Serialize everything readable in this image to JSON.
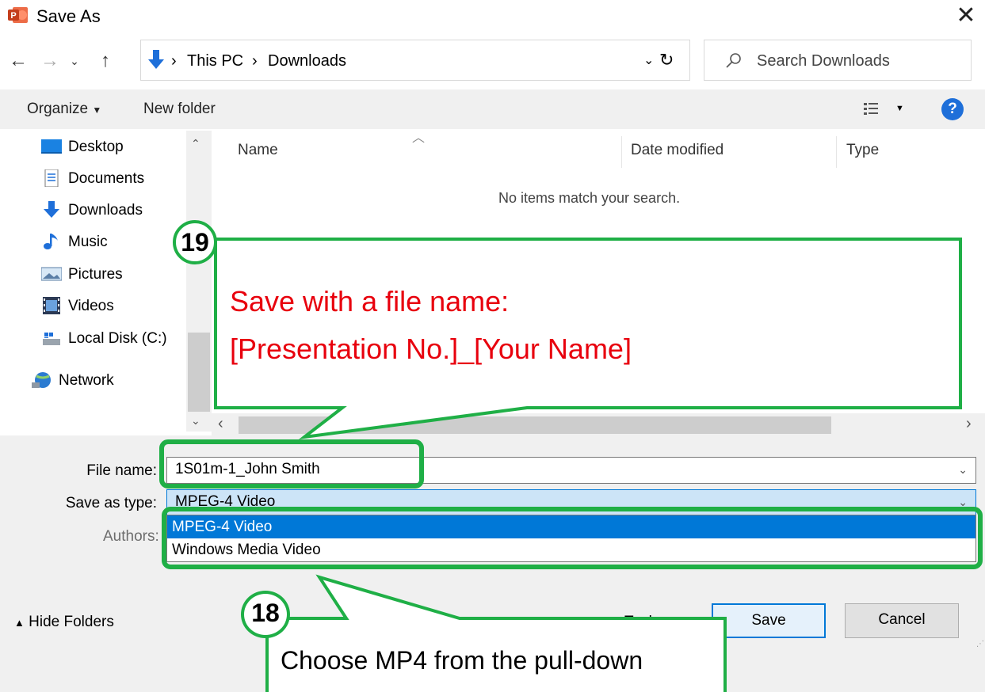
{
  "window": {
    "title": "Save As",
    "app_icon": "powerpoint-icon",
    "close_icon": "close-icon"
  },
  "nav": {
    "back_icon": "back-arrow-icon",
    "forward_icon": "forward-arrow-icon",
    "recent_icon": "chevron-down-icon",
    "up_icon": "up-arrow-icon",
    "breadcrumb": [
      "This PC",
      "Downloads"
    ],
    "refresh_icon": "refresh-icon",
    "search_placeholder": "Search Downloads"
  },
  "toolbar": {
    "organize": "Organize",
    "new_folder": "New folder",
    "view_icon": "view-options-icon",
    "help_icon": "help-icon"
  },
  "sidebar": {
    "items": [
      {
        "label": "Desktop",
        "icon": "desktop-icon"
      },
      {
        "label": "Documents",
        "icon": "documents-icon"
      },
      {
        "label": "Downloads",
        "icon": "downloads-icon"
      },
      {
        "label": "Music",
        "icon": "music-icon"
      },
      {
        "label": "Pictures",
        "icon": "pictures-icon"
      },
      {
        "label": "Videos",
        "icon": "videos-icon"
      },
      {
        "label": "Local Disk (C:)",
        "icon": "local-disk-icon"
      },
      {
        "label": "Network",
        "icon": "network-icon"
      }
    ]
  },
  "filelist": {
    "columns": [
      "Name",
      "Date modified",
      "Type"
    ],
    "empty_message": "No items match your search."
  },
  "form": {
    "file_name_label": "File name:",
    "file_name_value": "1S01m-1_John Smith",
    "save_type_label": "Save as type:",
    "save_type_value": "MPEG-4 Video",
    "authors_label": "Authors:",
    "dropdown_options": [
      "MPEG-4 Video",
      "Windows Media Video"
    ],
    "tools_label": "Tools",
    "hide_folders": "Hide Folders",
    "save": "Save",
    "cancel": "Cancel"
  },
  "callouts": {
    "step19_number": "19",
    "step19_line1": "Save with a file name:",
    "step19_line2": "[Presentation No.]_[Your Name]",
    "step18_number": "18",
    "step18_text": "Choose MP4 from the pull-down"
  },
  "colors": {
    "accent_green": "#1faf46",
    "callout_red": "#e8000d",
    "selection_blue": "#0078d7",
    "type_field_blue": "#cce4f7"
  }
}
